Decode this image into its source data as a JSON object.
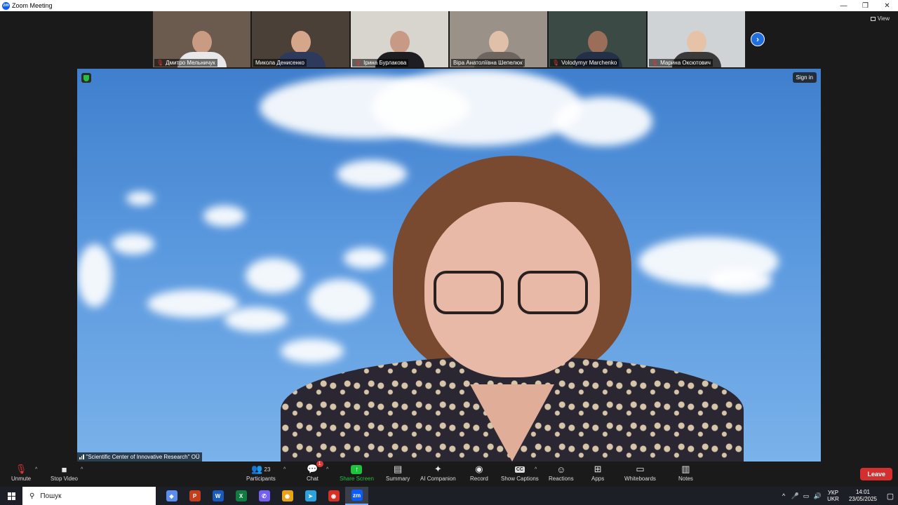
{
  "window": {
    "title": "Zoom Meeting",
    "logo": "zm",
    "controls": [
      "—",
      "❐",
      "✕"
    ]
  },
  "view_button": "View",
  "participants_strip": [
    {
      "name": "Дмитро Мельничук",
      "muted": true,
      "bg": "#6b5a4e",
      "head": "#c99b82",
      "body": "#e8e8ea"
    },
    {
      "name": "Микола Денисенко",
      "muted": false,
      "bg": "#4a4038",
      "head": "#d6a68a",
      "body": "#2e3a5c"
    },
    {
      "name": "Ірина  Бурлакова",
      "muted": true,
      "bg": "#d8d4ce",
      "head": "#c89a86",
      "body": "#1e1e22"
    },
    {
      "name": "Віра Анатоліївна Шепелюк",
      "muted": false,
      "bg": "#9a9288",
      "head": "#e0c0a8",
      "body": "#6d6660"
    },
    {
      "name": "Volodymyr Marchenko",
      "muted": true,
      "bg": "#3c4a46",
      "head": "#9a6e58",
      "body": "#243045"
    },
    {
      "name": "Марина Оксютович",
      "muted": true,
      "bg": "#cfd3d6",
      "head": "#e6c2a8",
      "body": "#3a3a3a"
    }
  ],
  "next_page_arrow": "›",
  "active_speaker": {
    "label": "\"Scientific Center of Innovative Research\" OÜ",
    "sign_in": "Sign in"
  },
  "toolbar": {
    "unmute": "Unmute",
    "stop_video": "Stop Video",
    "participants": "Participants",
    "participants_count": "23",
    "chat": "Chat",
    "chat_badge": "1",
    "share_screen": "Share Screen",
    "summary": "Summary",
    "ai_companion": "AI Companion",
    "record": "Record",
    "show_captions": "Show Captions",
    "captions_icon": "CC",
    "reactions": "Reactions",
    "apps": "Apps",
    "whiteboards": "Whiteboards",
    "notes": "Notes",
    "leave": "Leave"
  },
  "taskbar": {
    "search_placeholder": "Пошук",
    "apps": [
      {
        "name": "copilot",
        "glyph": "◈",
        "color": "#5b8def"
      },
      {
        "name": "powerpoint",
        "glyph": "P",
        "color": "#c43e1c"
      },
      {
        "name": "word",
        "glyph": "W",
        "color": "#185abd"
      },
      {
        "name": "excel",
        "glyph": "X",
        "color": "#107c41"
      },
      {
        "name": "viber",
        "glyph": "✆",
        "color": "#7360f2"
      },
      {
        "name": "chrome",
        "glyph": "◉",
        "color": "#e8a317"
      },
      {
        "name": "telegram",
        "glyph": "➤",
        "color": "#2aa3df"
      },
      {
        "name": "chrome-profile",
        "glyph": "◉",
        "color": "#d93025"
      },
      {
        "name": "zoom",
        "glyph": "zm",
        "color": "#0b5cff"
      }
    ],
    "lang_top": "УКР",
    "lang_bottom": "UKR",
    "time": "14:01",
    "date": "23/05/2025"
  }
}
